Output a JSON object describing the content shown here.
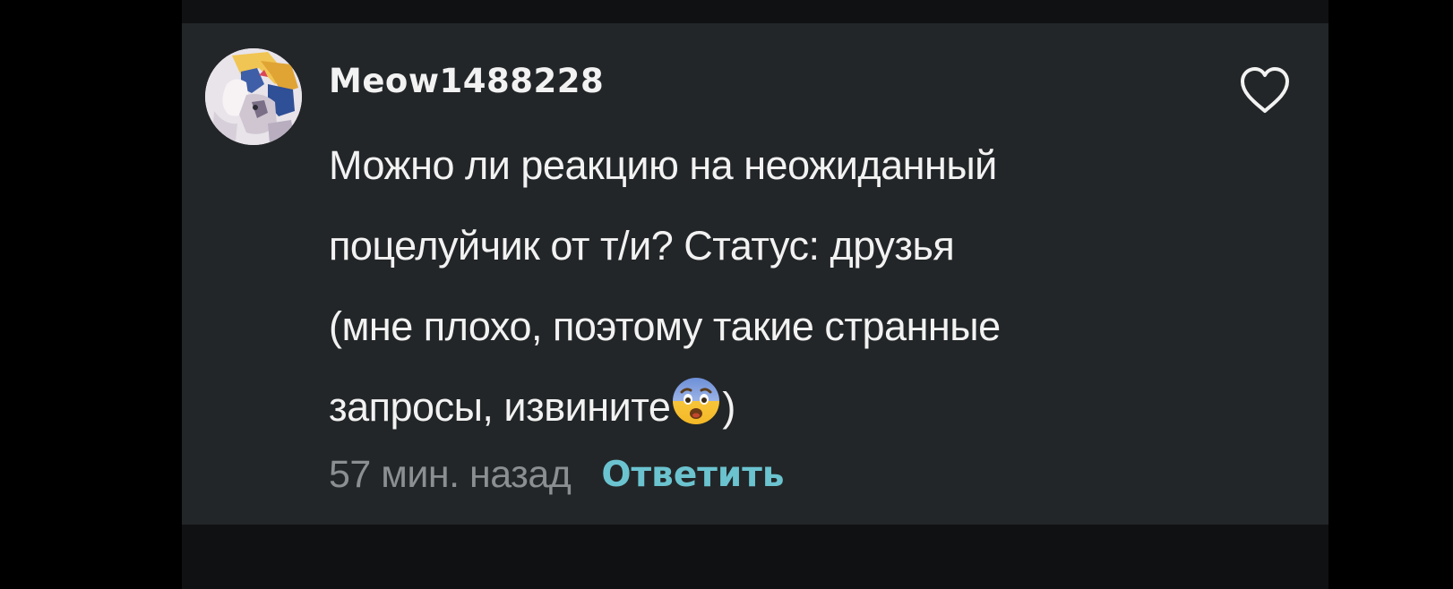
{
  "comment": {
    "avatar_icon": "user-avatar",
    "username": "Meow1488228",
    "text_before_emoji": "Можно ли реакцию на неожиданный\nпоцелуйчик от т/и? Статус: друзья\n(мне плохо, поэтому такие странные\nзапросы, извините",
    "emoji": "😨",
    "text_after_emoji": ")",
    "timestamp": "57 мин. назад",
    "reply_label": "Ответить",
    "like_icon": "heart-outline-icon"
  },
  "colors": {
    "page_background": "#000000",
    "card_background": "#232628",
    "text": "#f2f2f2",
    "muted_text": "#8b8f92",
    "accent": "#6bc3cf"
  }
}
